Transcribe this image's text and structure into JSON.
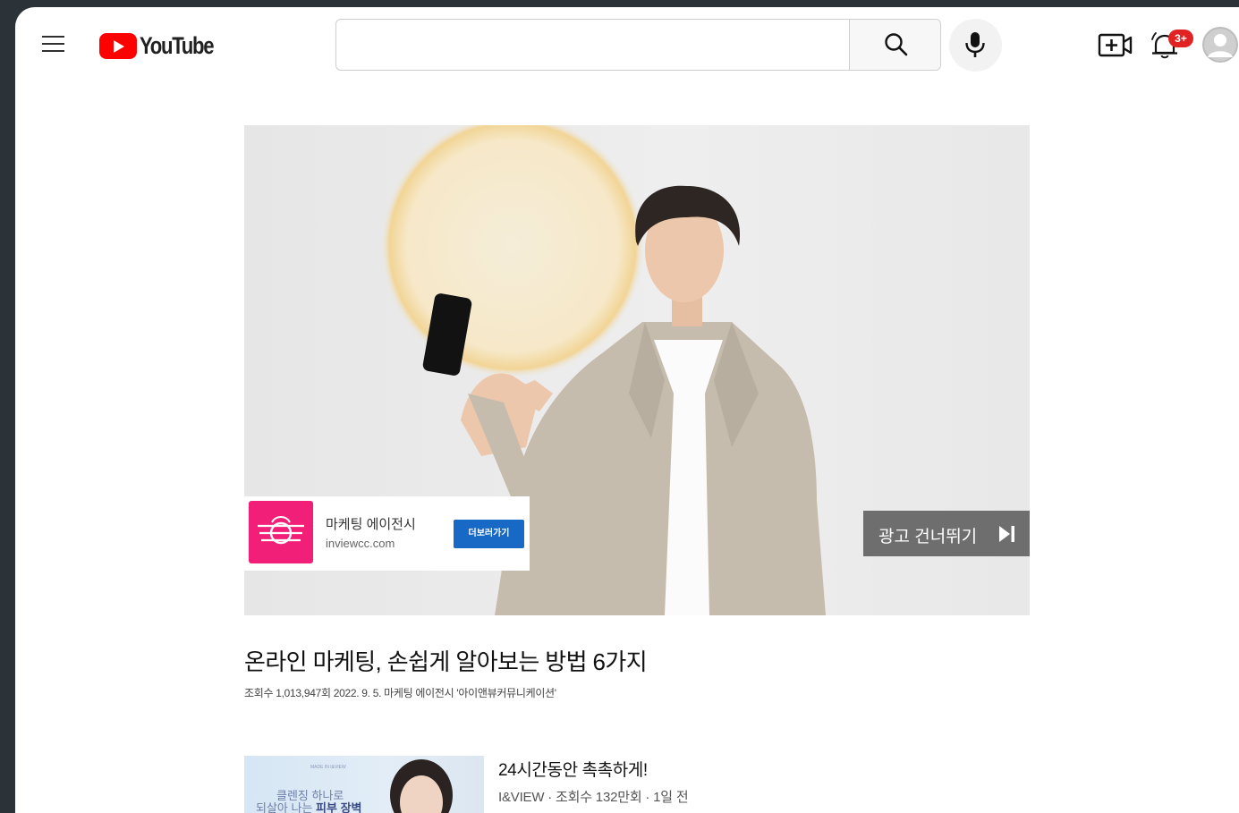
{
  "header": {
    "logo_text": "YouTube",
    "search_placeholder": "",
    "notification_badge": "3+",
    "icons": [
      "menu-icon",
      "search-icon",
      "mic-icon",
      "create-video-icon",
      "bell-icon",
      "avatar-icon"
    ]
  },
  "ad": {
    "advertiser_name": "마케팅 에이전시",
    "advertiser_url": "inviewcc.com",
    "cta_label": "더보러가기",
    "skip_label": "광고 건너뛰기"
  },
  "video": {
    "title": "온라인 마케팅, 손쉽게 알아보는 방법 6가지",
    "meta": "조회수 1,013,947회 2022. 9. 5. 마케팅 에이전시 '아이앤뷰커뮤니케이션'"
  },
  "recommendation": {
    "thumb_line1": "클렌징 하나로",
    "thumb_line2_prefix": "되살아 나는 ",
    "thumb_line2_bold": "피부 장벽",
    "title": "24시간동안 촉촉하게!",
    "meta": "I&VIEW · 조회수 132만회 · 1일 전"
  },
  "colors": {
    "brand_red": "#ff0000",
    "badge_red": "#e02222",
    "ad_logo_pink": "#f21f78",
    "cta_blue": "#1868c5",
    "skip_gray": "#6e6e6e"
  }
}
